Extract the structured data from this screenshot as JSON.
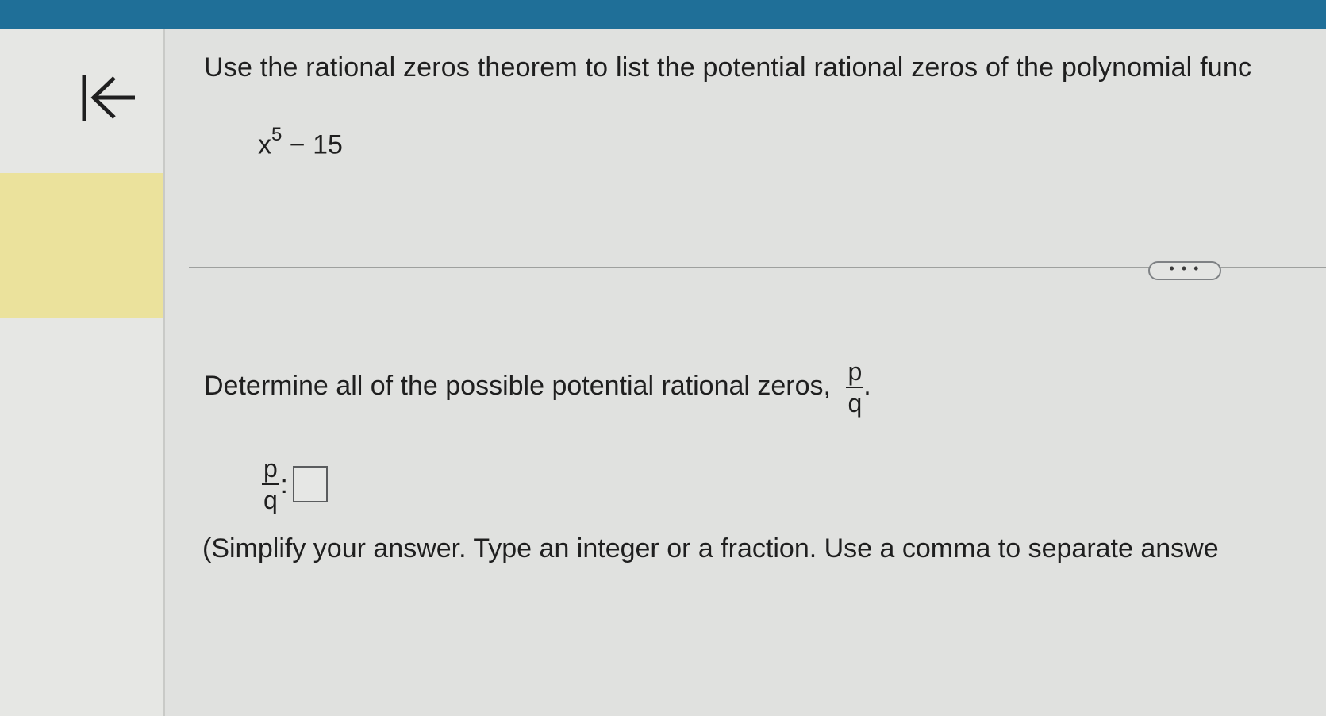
{
  "question": {
    "text": "Use the rational zeros theorem to list the potential rational zeros of the polynomial func",
    "polynomial_base": "x",
    "polynomial_exponent": "5",
    "polynomial_rest": " − 15"
  },
  "more_button": {
    "label": "• • •"
  },
  "part": {
    "prompt": "Determine all of the possible potential rational zeros,",
    "prompt_end": ".",
    "fraction_num": "p",
    "fraction_den": "q",
    "answer_label_colon": ":",
    "answer_value": "",
    "instructions": "(Simplify your answer.  Type an integer or a fraction.  Use a comma to separate answe"
  },
  "colors": {
    "top_bar": "#1f6f98",
    "highlight": "#ebe29c",
    "background": "#e0e1df"
  },
  "icons": {
    "back": "first-page-arrow-icon"
  }
}
